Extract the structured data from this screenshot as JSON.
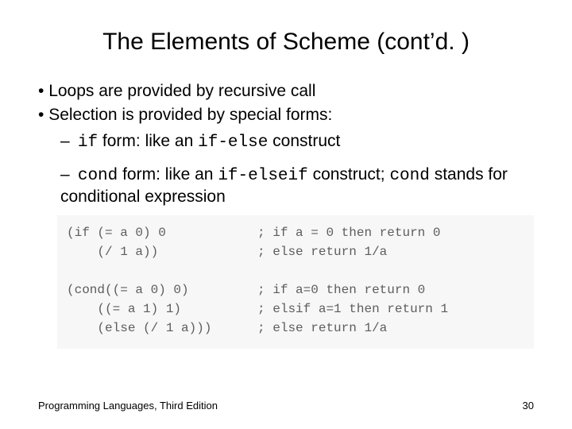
{
  "title": "The Elements of Scheme (cont’d. )",
  "bullets": {
    "b1": "Loops are provided by recursive call",
    "b2": "Selection is provided by special forms:",
    "s1_pre": "if",
    "s1_mid": " form: like an ",
    "s1_code": "if-else",
    "s1_post": " construct",
    "s2_pre": "cond",
    "s2_mid": " form: like an ",
    "s2_code": "if-elseif",
    "s2_post": " construct; ",
    "s2_code2": "cond",
    "s2_tail": " stands for conditional expression"
  },
  "code": "(if (= a 0) 0            ; if a = 0 then return 0\n    (/ 1 a))             ; else return 1/a\n\n(cond((= a 0) 0)         ; if a=0 then return 0\n    ((= a 1) 1)          ; elsif a=1 then return 1\n    (else (/ 1 a)))      ; else return 1/a",
  "footer": {
    "left": "Programming Languages, Third Edition",
    "right": "30"
  }
}
